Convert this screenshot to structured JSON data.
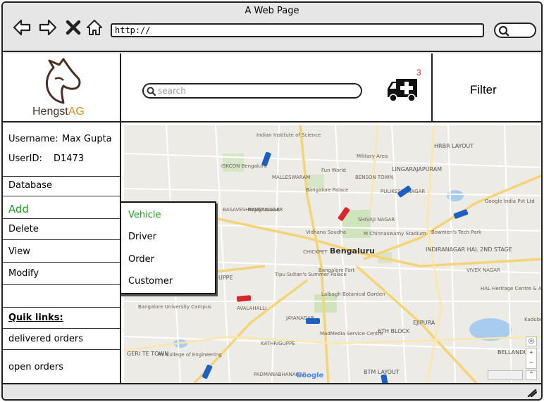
{
  "browser": {
    "title": "A Web Page",
    "url": "http://"
  },
  "header": {
    "logo_text_main": "Hengst",
    "logo_text_accent": "AG",
    "search_placeholder": "search",
    "notification_count": "3",
    "notification_icon": "ambulance-icon",
    "filter_label": "Filter"
  },
  "sidebar": {
    "username_label": "Username:",
    "username_value": "Max Gupta",
    "userid_label": "UserID:",
    "userid_value": "D1473",
    "database_label": "Database",
    "menu": [
      "Add",
      "Delete",
      "View",
      "Modify"
    ],
    "quick_links_label": "Quik links:",
    "quick_links": [
      "delivered orders",
      "open orders"
    ]
  },
  "dropdown": {
    "items": [
      "Vehicle",
      "Driver",
      "Order",
      "Customer"
    ],
    "active": "Vehicle"
  },
  "map": {
    "city": "Bengaluru",
    "attribution": "Google",
    "labels": [
      "Indian Institute of Science",
      "Military Area",
      "LINGARAJAPURAM",
      "HRBR LAYOUT",
      "ISKCON Bengaluru",
      "MALLESWARAM",
      "Fun World",
      "BENSON TOWN",
      "Bangalore Palace",
      "PULIKESHI NAGAR",
      "Google India Pvt Ltd",
      "BASAVESHWARA NAGAR",
      "RAJAJINAGAR",
      "SHIVAJI NAGAR",
      "Vidhana Soudha",
      "M Chinnaswamy Stadium",
      "Bowmen's Tech Park",
      "CHICKPET",
      "INDIRANAGAR HAL 2ND STAGE",
      "VIVEK NAGAR",
      "Bangalore Fort",
      "Tipu Sultan's Summer Palace",
      "Lalbagh Botanical Garden",
      "HAL Heritage Centre & Aerospace Museum",
      "Bangalore University Campus",
      "AVALAHALLI",
      "JAYANAGAR",
      "MadMedia Service Centre",
      "6TH BLOCK",
      "EJIPURA",
      "RV College of Engineering",
      "BTM LAYOUT",
      "BELLANDUR",
      "PADMANABHANAGAR",
      "KATHRIGUPPE",
      "UPPE",
      "GERI TE TOWN",
      "Kadubeesanahalli"
    ]
  }
}
